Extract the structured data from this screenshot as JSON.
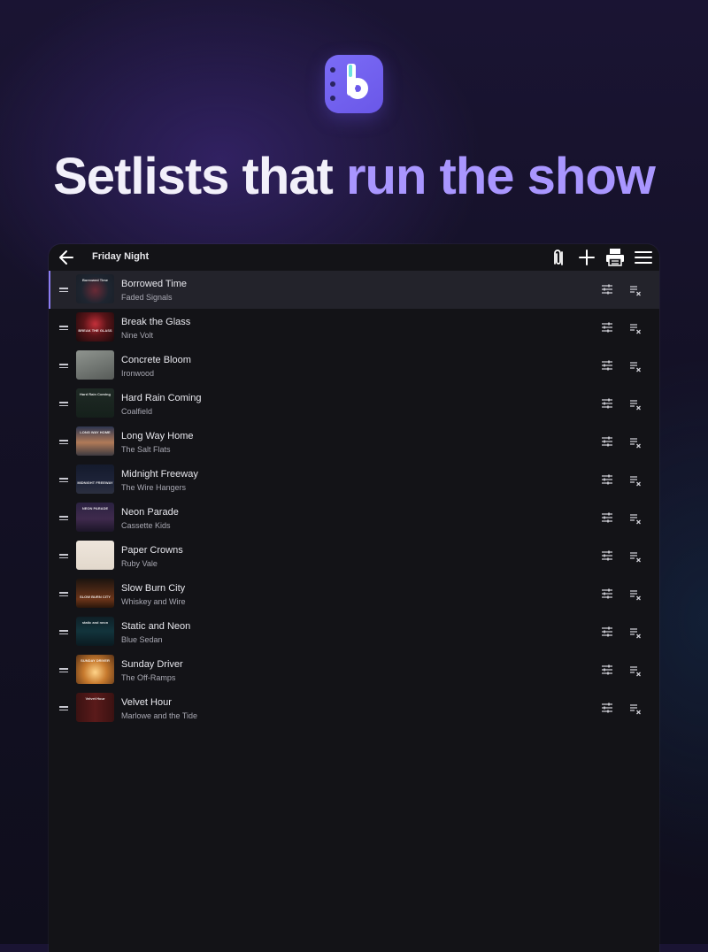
{
  "headline": {
    "part1": "Setlists that ",
    "part2": "run the show"
  },
  "colors": {
    "accent": "#a996ff",
    "brand": "#6a57e8",
    "active_bar": "#8b7cf4"
  },
  "appbar": {
    "title": "Friday Night",
    "icons": [
      "back-arrow-icon",
      "attach-icon",
      "add-icon",
      "printer-icon",
      "menu-icon"
    ]
  },
  "songs": [
    {
      "title": "Borrowed Time",
      "artist": "Faded Signals",
      "art_caption": "Borrowed Time",
      "active": true
    },
    {
      "title": "Break the Glass",
      "artist": "Nine Volt",
      "art_caption": "BREAK THE GLASS"
    },
    {
      "title": "Concrete Bloom",
      "artist": "Ironwood",
      "art_caption": ""
    },
    {
      "title": "Hard Rain Coming",
      "artist": "Coalfield",
      "art_caption": "Hard Rain Coming"
    },
    {
      "title": "Long Way Home",
      "artist": "The Salt Flats",
      "art_caption": "LONG WAY HOME"
    },
    {
      "title": "Midnight Freeway",
      "artist": "The Wire Hangers",
      "art_caption": "MIDNIGHT FREEWAY"
    },
    {
      "title": "Neon Parade",
      "artist": "Cassette Kids",
      "art_caption": "NEON PARADE"
    },
    {
      "title": "Paper Crowns",
      "artist": "Ruby Vale",
      "art_caption": ""
    },
    {
      "title": "Slow Burn City",
      "artist": "Whiskey and Wire",
      "art_caption": "SLOW BURN CITY"
    },
    {
      "title": "Static and Neon",
      "artist": "Blue Sedan",
      "art_caption": "static and neon"
    },
    {
      "title": "Sunday Driver",
      "artist": "The Off-Ramps",
      "art_caption": "SUNDAY DRIVER"
    },
    {
      "title": "Velvet Hour",
      "artist": "Marlowe and the Tide",
      "art_caption": "Velvet Hour"
    }
  ]
}
